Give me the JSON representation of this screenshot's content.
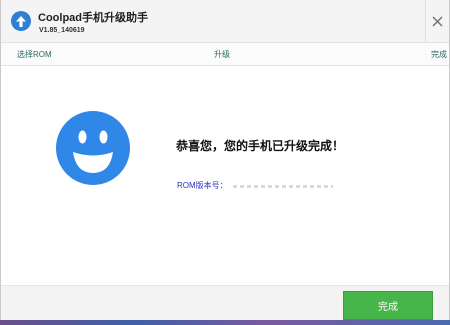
{
  "app": {
    "title": "Coolpad手机升级助手",
    "version": "V1.85_140619",
    "logo_icon": "upload-arrow-icon",
    "close_icon": "close-icon"
  },
  "steps": [
    {
      "label": "选择ROM"
    },
    {
      "label": "升级"
    },
    {
      "label": "完成"
    }
  ],
  "main": {
    "status_icon": "smiley-face-icon",
    "message": "恭喜您，您的手机已升级完成！",
    "rom_label": "ROM版本号：",
    "rom_value": ""
  },
  "footer": {
    "finish_label": "完成"
  },
  "colors": {
    "accent_blue": "#2f7fd6",
    "smiley_blue": "#2f88e8",
    "step_text": "#2b6b60",
    "rom_label_text": "#2d2fbf",
    "finish_button": "#46b54a"
  }
}
